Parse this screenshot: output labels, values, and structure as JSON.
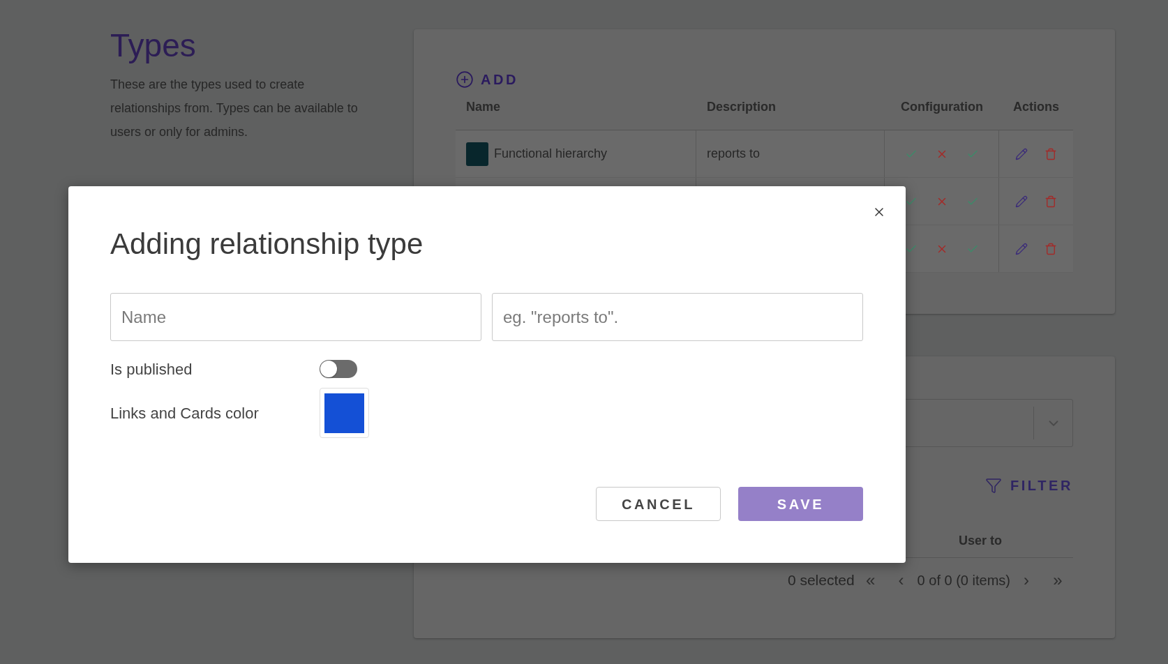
{
  "page": {
    "title": "Types",
    "description": "These are the types used to create relationships from. Types can be available to users or only for admins."
  },
  "types_card": {
    "add_button": "ADD",
    "columns": [
      "Name",
      "Description",
      "Configuration",
      "Actions"
    ],
    "rows": [
      {
        "name": "Functional hierarchy",
        "description": "reports to",
        "color": "#08262c",
        "configuration": [
          true,
          false,
          true
        ]
      },
      {
        "configuration": [
          true,
          false,
          true
        ]
      },
      {
        "configuration": [
          true,
          false,
          true
        ]
      }
    ]
  },
  "users_card": {
    "filter_button": "FILTER",
    "columns": [
      "User to"
    ],
    "pagination": {
      "selected": "0 selected",
      "range": "0 of 0 (0 items)",
      "buttons": [
        {
          "label": "«",
          "disabled": true
        },
        {
          "label": "‹",
          "disabled": true
        },
        {
          "label": "›",
          "disabled": true
        },
        {
          "label": "»",
          "disabled": true
        }
      ]
    }
  },
  "dialog": {
    "title": "Adding relationship type",
    "fields": [
      {
        "placeholder": "Name"
      },
      {
        "placeholder": "eg. \"reports to\"."
      }
    ],
    "published": {
      "label": "Is published",
      "on": false
    },
    "color_field": {
      "label": "Links and Cards color",
      "color": "#1450d6"
    },
    "buttons": [
      {
        "label": "CANCEL",
        "kind": "secondary",
        "disabled": false
      },
      {
        "label": "SAVE",
        "kind": "primary",
        "disabled": true
      }
    ]
  }
}
